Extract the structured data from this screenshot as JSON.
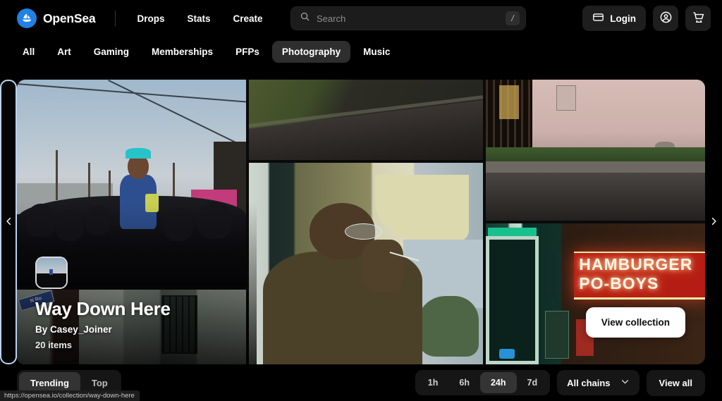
{
  "brand": {
    "name": "OpenSea",
    "logo_icon": "sailboat-icon",
    "accent": "#2081e2"
  },
  "nav": {
    "links": [
      {
        "label": "Drops"
      },
      {
        "label": "Stats"
      },
      {
        "label": "Create"
      }
    ]
  },
  "search": {
    "placeholder": "Search",
    "shortcut": "/",
    "icon": "search-icon",
    "value": ""
  },
  "account": {
    "login_label": "Login",
    "wallet_icon": "wallet-icon",
    "profile_icon": "profile-circle-icon",
    "cart_icon": "shopping-cart-icon"
  },
  "categories": {
    "items": [
      {
        "label": "All",
        "active": false
      },
      {
        "label": "Art",
        "active": false
      },
      {
        "label": "Gaming",
        "active": false
      },
      {
        "label": "Memberships",
        "active": false
      },
      {
        "label": "PFPs",
        "active": false
      },
      {
        "label": "Photography",
        "active": true
      },
      {
        "label": "Music",
        "active": false
      }
    ]
  },
  "hero": {
    "title": "Way Down Here",
    "creator": "By Casey_Joiner",
    "items_count": "20 items",
    "cta_label": "View collection",
    "prev_icon": "chevron-left-icon",
    "next_icon": "chevron-right-icon",
    "avatar_icon": "collection-avatar",
    "neon_sign": {
      "line1": "HAMBURGER",
      "line2": "PO-BOYS"
    },
    "street_sign": "N Ro"
  },
  "bottom": {
    "tabs": [
      {
        "label": "Trending",
        "active": true
      },
      {
        "label": "Top",
        "active": false
      }
    ],
    "timeframes": [
      {
        "label": "1h",
        "active": false
      },
      {
        "label": "6h",
        "active": false
      },
      {
        "label": "24h",
        "active": true
      },
      {
        "label": "7d",
        "active": false
      }
    ],
    "chain_filter": {
      "label": "All chains",
      "icon": "chevron-down-icon"
    },
    "view_all_label": "View all"
  },
  "statusbar": {
    "url": "https://opensea.io/collection/way-down-here"
  }
}
